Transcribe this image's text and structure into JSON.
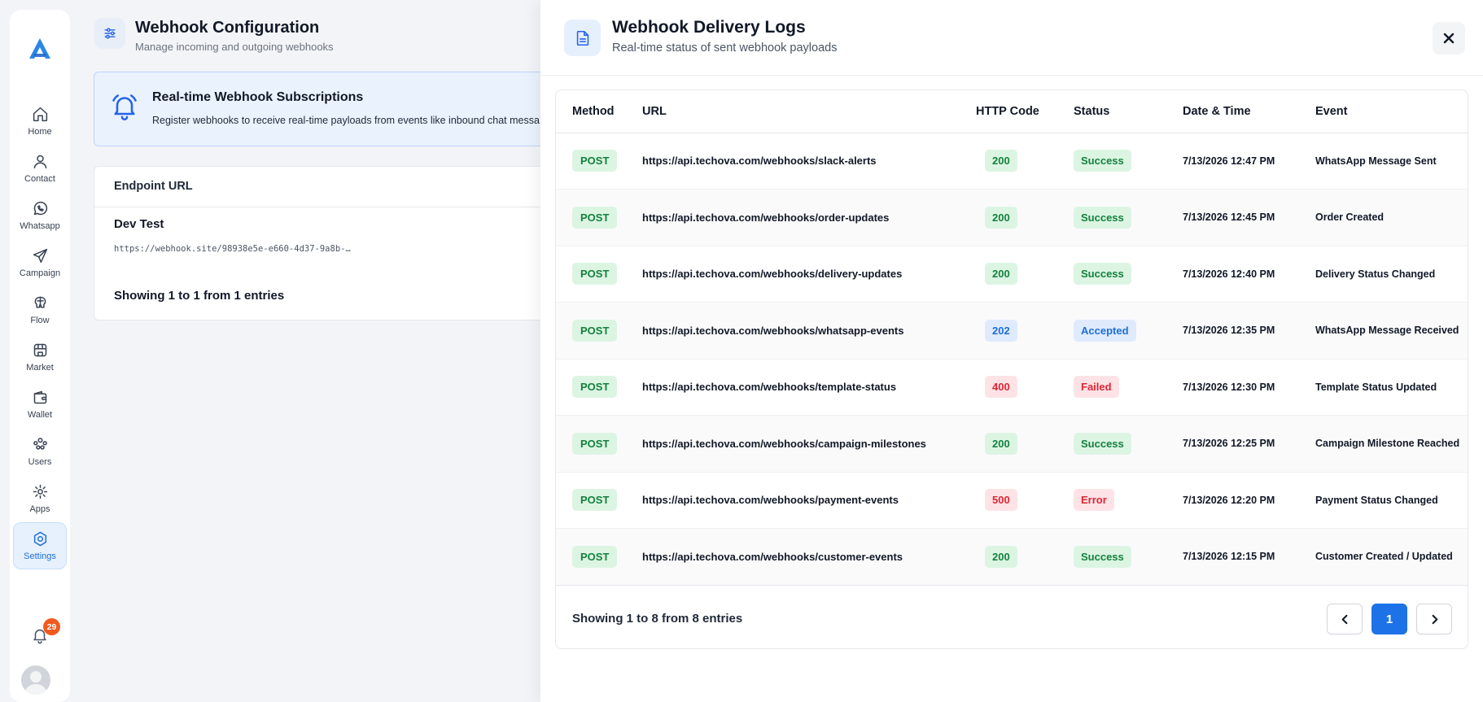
{
  "sidebar": {
    "items": [
      {
        "label": "Home",
        "icon": "home-icon"
      },
      {
        "label": "Contact",
        "icon": "contact-icon"
      },
      {
        "label": "Whatsapp",
        "icon": "whatsapp-icon"
      },
      {
        "label": "Campaign",
        "icon": "send-icon"
      },
      {
        "label": "Flow",
        "icon": "flow-icon"
      },
      {
        "label": "Market",
        "icon": "store-icon"
      },
      {
        "label": "Wallet",
        "icon": "wallet-icon"
      },
      {
        "label": "Users",
        "icon": "users-icon"
      },
      {
        "label": "Apps",
        "icon": "apps-icon"
      },
      {
        "label": "Settings",
        "icon": "gear-icon"
      }
    ],
    "active": "Settings",
    "notifications_count": "29"
  },
  "header": {
    "title": "Webhook Configuration",
    "subtitle": "Manage incoming and outgoing webhooks"
  },
  "info_card": {
    "title": "Real-time Webhook Subscriptions",
    "text": "Register webhooks to receive real-time payloads from events like inbound chat messa"
  },
  "endpoint_card": {
    "header": "Endpoint URL",
    "name": "Dev Test",
    "url": "https://webhook.site/98938e5e-e660-4d37-9a8b-…",
    "footer": "Showing 1 to 1 from 1 entries"
  },
  "panel": {
    "title": "Webhook Delivery Logs",
    "subtitle": "Real-time status of sent webhook payloads",
    "columns": [
      "Method",
      "URL",
      "HTTP Code",
      "Status",
      "Date & Time",
      "Event"
    ],
    "rows": [
      {
        "method": "POST",
        "url": "https://api.techova.com/webhooks/slack-alerts",
        "code": "200",
        "status": "Success",
        "tone": "ok",
        "datetime": "7/13/2026 12:47 PM",
        "event": "WhatsApp Message Sent"
      },
      {
        "method": "POST",
        "url": "https://api.techova.com/webhooks/order-updates",
        "code": "200",
        "status": "Success",
        "tone": "ok",
        "datetime": "7/13/2026 12:45 PM",
        "event": "Order Created"
      },
      {
        "method": "POST",
        "url": "https://api.techova.com/webhooks/delivery-updates",
        "code": "200",
        "status": "Success",
        "tone": "ok",
        "datetime": "7/13/2026 12:40 PM",
        "event": "Delivery Status Changed"
      },
      {
        "method": "POST",
        "url": "https://api.techova.com/webhooks/whatsapp-events",
        "code": "202",
        "status": "Accepted",
        "tone": "info",
        "datetime": "7/13/2026 12:35 PM",
        "event": "WhatsApp Message Received"
      },
      {
        "method": "POST",
        "url": "https://api.techova.com/webhooks/template-status",
        "code": "400",
        "status": "Failed",
        "tone": "bad",
        "datetime": "7/13/2026 12:30 PM",
        "event": "Template Status Updated"
      },
      {
        "method": "POST",
        "url": "https://api.techova.com/webhooks/campaign-milestones",
        "code": "200",
        "status": "Success",
        "tone": "ok",
        "datetime": "7/13/2026 12:25 PM",
        "event": "Campaign Milestone Reached"
      },
      {
        "method": "POST",
        "url": "https://api.techova.com/webhooks/payment-events",
        "code": "500",
        "status": "Error",
        "tone": "bad",
        "datetime": "7/13/2026 12:20 PM",
        "event": "Payment Status Changed"
      },
      {
        "method": "POST",
        "url": "https://api.techova.com/webhooks/customer-events",
        "code": "200",
        "status": "Success",
        "tone": "ok",
        "datetime": "7/13/2026 12:15 PM",
        "event": "Customer Created / Updated"
      }
    ],
    "footer": "Showing 1 to 8 from 8 entries",
    "current_page": "1"
  },
  "colors": {
    "accent": "#1d72e8",
    "success": "#15803d",
    "info": "#1d6fd8",
    "danger": "#dc2636",
    "badge": "#f15a1f"
  }
}
